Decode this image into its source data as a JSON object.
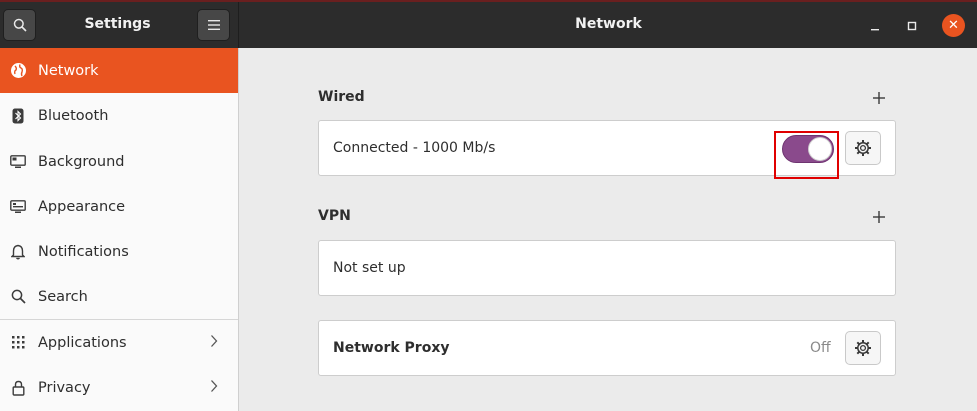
{
  "titlebar": {
    "left_title": "Settings",
    "main_title": "Network",
    "close_glyph": "✕"
  },
  "sidebar": {
    "items": [
      {
        "label": "Network",
        "icon": "network-globe-icon"
      },
      {
        "label": "Bluetooth",
        "icon": "bluetooth-icon"
      },
      {
        "label": "Background",
        "icon": "background-monitor-icon"
      },
      {
        "label": "Appearance",
        "icon": "appearance-monitor-icon"
      },
      {
        "label": "Notifications",
        "icon": "bell-icon"
      },
      {
        "label": "Search",
        "icon": "search-icon"
      },
      {
        "label": "Applications",
        "icon": "apps-grid-icon"
      },
      {
        "label": "Privacy",
        "icon": "lock-icon"
      }
    ]
  },
  "main": {
    "wired": {
      "title": "Wired",
      "status": "Connected - 1000 Mb/s",
      "toggle_on": true
    },
    "vpn": {
      "title": "VPN",
      "status": "Not set up"
    },
    "proxy": {
      "title": "Network Proxy",
      "status": "Off"
    }
  },
  "colors": {
    "accent": "#e95420",
    "toggle_on": "#8a4a8c",
    "titlebar": "#2c2c2c",
    "highlight_frame": "#e00000"
  }
}
